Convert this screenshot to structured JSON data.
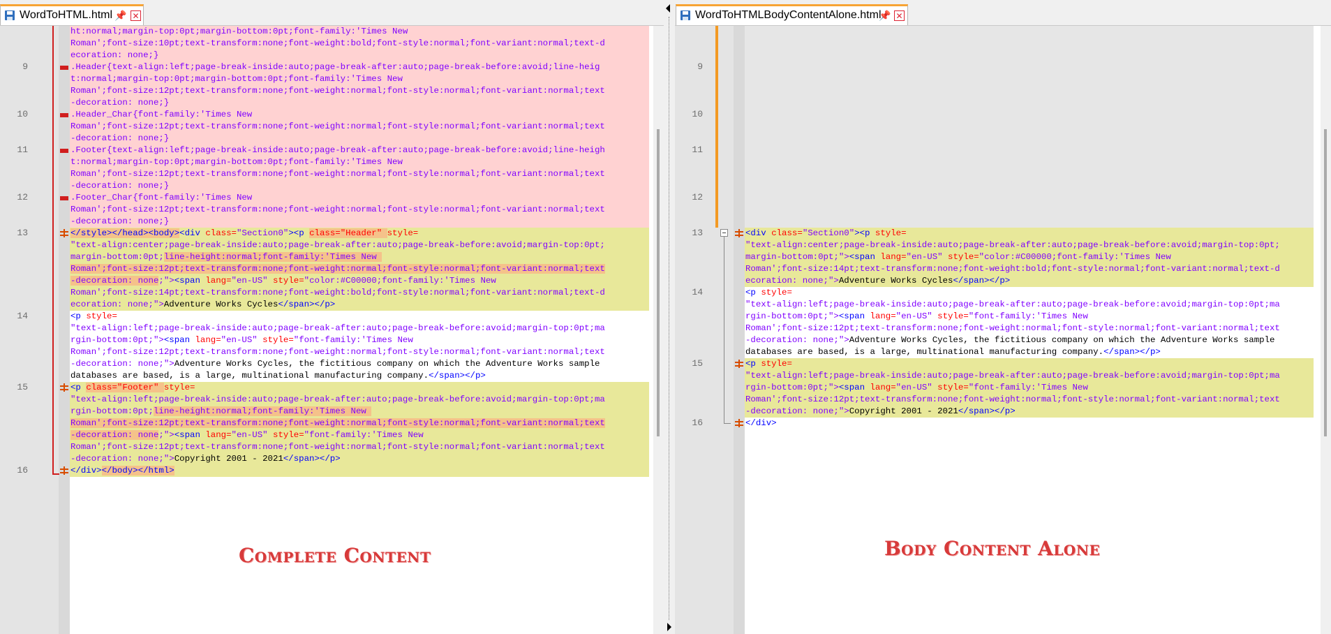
{
  "left_tab": {
    "label": "WordToHTML.html",
    "pin": "pin-icon",
    "close": "close-icon"
  },
  "right_tab": {
    "label": "WordToHTMLBodyContentAlone.html",
    "pin": "pin-icon",
    "close": "close-icon"
  },
  "left_lines": {
    "l9": "9",
    "l10": "10",
    "l11": "11",
    "l12": "12",
    "l13": "13",
    "l14": "14",
    "l15": "15",
    "l16": "16"
  },
  "right_lines": {
    "l9": "9",
    "l10": "10",
    "l11": "11",
    "l12": "12",
    "l13": "13",
    "l14": "14",
    "l15": "15",
    "l16": "16"
  },
  "left_code": {
    "r0": "ht:normal;margin-top:0pt;margin-bottom:0pt;font-family:'Times New",
    "r1": "Roman';font-size:10pt;text-transform:none;font-weight:bold;font-style:normal;font-variant:normal;text-d",
    "r2": "ecoration: none;}",
    "r3": ".Header{text-align:left;page-break-inside:auto;page-break-after:auto;page-break-before:avoid;line-heig",
    "r4": "t:normal;margin-top:0pt;margin-bottom:0pt;font-family:'Times New",
    "r5": "Roman';font-size:12pt;text-transform:none;font-weight:normal;font-style:normal;font-variant:normal;text",
    "r6": "-decoration: none;}",
    "r7": ".Header_Char{font-family:'Times New",
    "r8": "Roman';font-size:12pt;text-transform:none;font-weight:normal;font-style:normal;font-variant:normal;text",
    "r9": "-decoration: none;}",
    "r10": ".Footer{text-align:left;page-break-inside:auto;page-break-after:auto;page-break-before:avoid;line-heigh",
    "r11": "t:normal;margin-top:0pt;margin-bottom:0pt;font-family:'Times New",
    "r12": "Roman';font-size:12pt;text-transform:none;font-weight:normal;font-style:normal;font-variant:normal;text",
    "r13": "-decoration: none;}",
    "r14": ".Footer_Char{font-family:'Times New",
    "r15": "Roman';font-size:12pt;text-transform:none;font-weight:normal;font-style:normal;font-variant:normal;text",
    "r16": "-decoration: none;}",
    "r17a": "</style></head><body>",
    "r17b": "<div ",
    "r17c": "class=",
    "r17d": "\"Section0\"",
    "r17e": "><p ",
    "r17f": "class=\"Header\" ",
    "r17g": "style=",
    "r18": "\"text-align:center;page-break-inside:auto;page-break-after:auto;page-break-before:avoid;margin-top:0pt;",
    "r19a": "margin-bottom:0pt;",
    "r19b": "line-height:normal;font-family:'Times New ",
    "r20": "Roman';font-size:12pt;text-transform:none;font-weight:normal;font-style:normal;font-variant:normal;text",
    "r21a": "-decoration: none",
    "r21b": ";\">",
    "r21c": "<span ",
    "r21d": "lang=",
    "r21e": "\"en-US\" ",
    "r21f": "style=",
    "r21g": "\"color:#C00000;font-family:'Times New",
    "r22": "Roman';font-size:14pt;text-transform:none;font-weight:bold;font-style:normal;font-variant:normal;text-d",
    "r23a": "ecoration: none;\">",
    "r23b": "Adventure Works Cycles",
    "r23c": "</span></p>",
    "r24a": "<p ",
    "r24b": "style=",
    "r25": "\"text-align:left;page-break-inside:auto;page-break-after:auto;page-break-before:avoid;margin-top:0pt;ma",
    "r26a": "rgin-bottom:0pt;\">",
    "r26b": "<span ",
    "r26c": "lang=",
    "r26d": "\"en-US\" ",
    "r26e": "style=",
    "r26f": "\"font-family:'Times New",
    "r27": "Roman';font-size:12pt;text-transform:none;font-weight:normal;font-style:normal;font-variant:normal;text",
    "r28a": "-decoration: none;\">",
    "r28b": "Adventure Works Cycles, the fictitious company on which the Adventure Works sample",
    "r29a": "databases are based, is a large, multinational manufacturing company.",
    "r29b": "</span></p>",
    "r30a": "<p ",
    "r30b": "class=\"Footer\" ",
    "r30c": "style=",
    "r31": "\"text-align:left;page-break-inside:auto;page-break-after:auto;page-break-before:avoid;margin-top:0pt;ma",
    "r32a": "rgin-bottom:0pt;",
    "r32b": "line-height:normal;font-family:'Times New ",
    "r33": "Roman';font-size:12pt;text-transform:none;font-weight:normal;font-style:normal;font-variant:normal;text",
    "r34a": "-decoration: none",
    "r34b": ";\">",
    "r34c": "<span ",
    "r34d": "lang=",
    "r34e": "\"en-US\" ",
    "r34f": "style=",
    "r34g": "\"font-family:'Times New",
    "r35": "Roman';font-size:12pt;text-transform:none;font-weight:normal;font-style:normal;font-variant:normal;text",
    "r36a": "-decoration: none;\">",
    "r36b": "Copyright 2001 - 2021",
    "r36c": "</span></p>",
    "r37a": "</div>",
    "r37b": "</body></html>"
  },
  "right_code": {
    "r0a": "<div ",
    "r0b": "class=",
    "r0c": "\"Section0\"",
    "r0d": "><p ",
    "r0e": "style=",
    "r1": "\"text-align:center;page-break-inside:auto;page-break-after:auto;page-break-before:avoid;margin-top:0pt;",
    "r2a": "margin-bottom:0pt;\">",
    "r2b": "<span ",
    "r2c": "lang=",
    "r2d": "\"en-US\" ",
    "r2e": "style=",
    "r2f": "\"color:#C00000;font-family:'Times New",
    "r3": "Roman';font-size:14pt;text-transform:none;font-weight:bold;font-style:normal;font-variant:normal;text-d",
    "r4a": "ecoration: none;\">",
    "r4b": "Adventure Works Cycles",
    "r4c": "</span></p>",
    "r5a": "<p ",
    "r5b": "style=",
    "r6": "\"text-align:left;page-break-inside:auto;page-break-after:auto;page-break-before:avoid;margin-top:0pt;ma",
    "r7a": "rgin-bottom:0pt;\">",
    "r7b": "<span ",
    "r7c": "lang=",
    "r7d": "\"en-US\" ",
    "r7e": "style=",
    "r7f": "\"font-family:'Times New",
    "r8": "Roman';font-size:12pt;text-transform:none;font-weight:normal;font-style:normal;font-variant:normal;text",
    "r9a": "-decoration: none;\">",
    "r9b": "Adventure Works Cycles, the fictitious company on which the Adventure Works sample",
    "r10a": "databases are based, is a large, multinational manufacturing company.",
    "r10b": "</span></p>",
    "r11a": "<p ",
    "r11b": "style=",
    "r12": "\"text-align:left;page-break-inside:auto;page-break-after:auto;page-break-before:avoid;margin-top:0pt;ma",
    "r13a": "rgin-bottom:0pt;\">",
    "r13b": "<span ",
    "r13c": "lang=",
    "r13d": "\"en-US\" ",
    "r13e": "style=",
    "r13f": "\"font-family:'Times New",
    "r14": "Roman';font-size:12pt;text-transform:none;font-weight:normal;font-style:normal;font-variant:normal;text",
    "r15a": "-decoration: none;\">",
    "r15b": "Copyright 2001 - 2021",
    "r15c": "</span></p>",
    "r16": "</div>"
  },
  "annotations": {
    "left": "Complete Content",
    "right": "Body Content Alone"
  },
  "colors": {
    "deleted_bg": "#ffd2d2",
    "changed_bg": "#e8e89a",
    "inline_change_bg": "#f5c28a",
    "tab_accent": "#f7a434",
    "annotation": "#d73a3a"
  }
}
